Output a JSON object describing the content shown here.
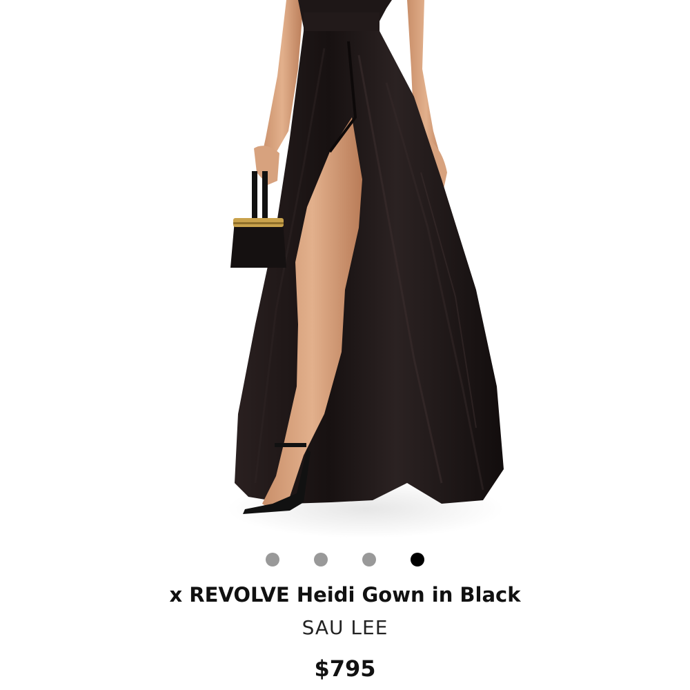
{
  "product": {
    "title": "x REVOLVE Heidi Gown in Black",
    "brand": "SAU LEE",
    "price": "$795"
  },
  "carousel": {
    "total": 4,
    "active_index": 3
  },
  "colors": {
    "dot_inactive": "#999999",
    "dot_active": "#000000",
    "gown": "#1a1414"
  }
}
